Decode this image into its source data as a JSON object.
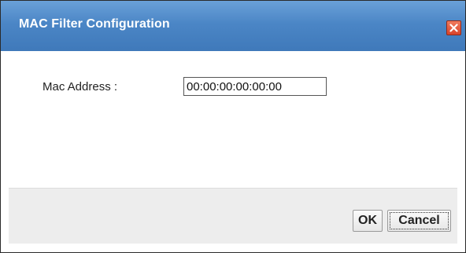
{
  "dialog": {
    "title": "MAC Filter Configuration",
    "close_icon": "close-icon"
  },
  "form": {
    "mac_label": "Mac Address :",
    "mac_value": "00:00:00:00:00:00"
  },
  "buttons": {
    "ok_label": "OK",
    "cancel_label": "Cancel"
  },
  "colors": {
    "titlebar": "#4b86c6",
    "close_button": "#d9432a",
    "footer": "#ededed"
  }
}
